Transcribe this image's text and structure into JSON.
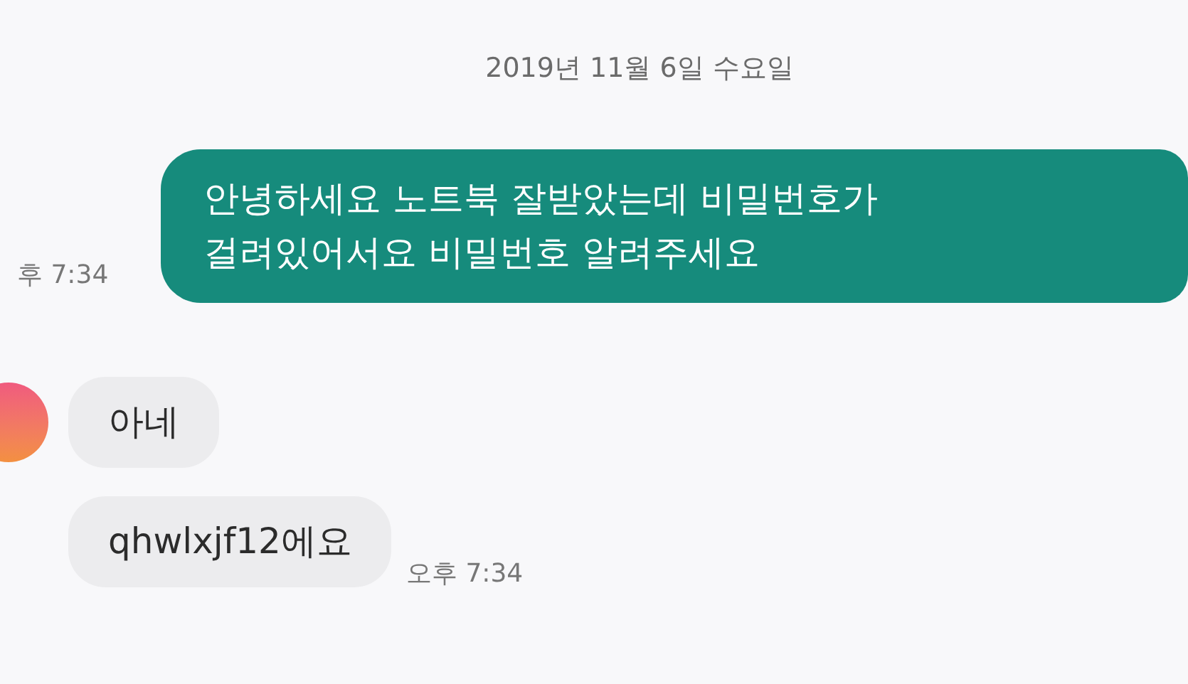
{
  "date_divider": "2019년 11월 6일 수요일",
  "messages": [
    {
      "kind": "outgoing",
      "lines": [
        "안녕하세요 노트북 잘받았는데 비밀번호가",
        "걸려있어서요 비밀번호 알려주세요"
      ],
      "time": "후 7:34"
    },
    {
      "kind": "incoming",
      "lines": [
        "아네"
      ]
    },
    {
      "kind": "incoming",
      "lines": [
        "qhwlxjf12에요"
      ],
      "time": "오후 7:34"
    }
  ]
}
